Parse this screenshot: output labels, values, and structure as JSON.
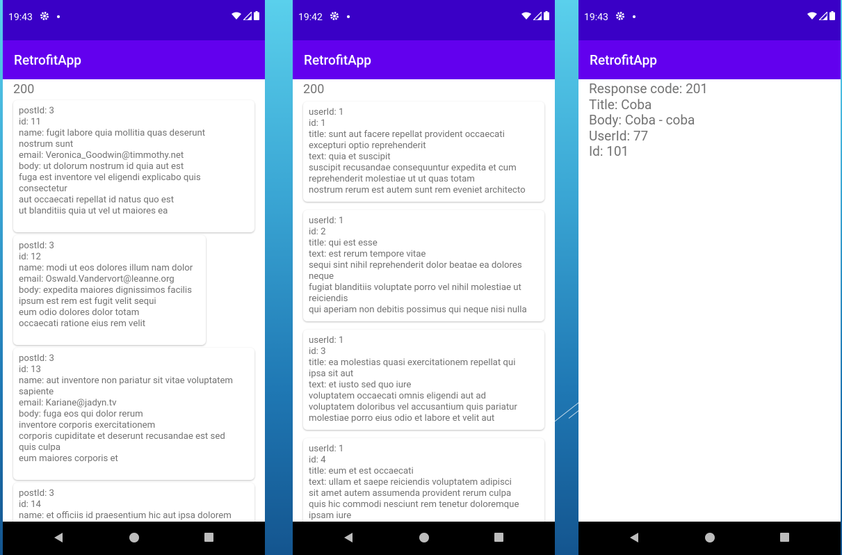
{
  "colors": {
    "status_bar": "#3a00c6",
    "app_bar": "#6200ee",
    "text": "#737373"
  },
  "phones": [
    {
      "status_time": "19:43",
      "app_title": "RetrofitApp",
      "code": "200",
      "cards": [
        {
          "lines": [
            "postId: 3",
            "id: 11",
            "name: fugit labore quia mollitia quas deserunt",
            "nostrum sunt",
            "email: Veronica_Goodwin@timmothy.net",
            "body: ut dolorum nostrum id quia aut est",
            "fuga est inventore vel eligendi explicabo quis",
            "consectetur",
            "aut occaecati repellat id natus quo est",
            "ut blanditiis quia ut vel ut maiores ea"
          ]
        },
        {
          "lines": [
            "postId: 3",
            "id: 12",
            "name: modi ut eos dolores illum nam dolor",
            "email: Oswald.Vandervort@leanne.org",
            "body: expedita maiores dignissimos facilis",
            "ipsum est rem est fugit velit sequi",
            "eum odio dolores dolor totam",
            "occaecati ratione eius rem velit"
          ]
        },
        {
          "lines": [
            "postId: 3",
            "id: 13",
            "name: aut inventore non pariatur sit vitae voluptatem",
            "sapiente",
            "email: Kariane@jadyn.tv",
            "body: fuga eos qui dolor rerum",
            "inventore corporis exercitationem",
            "corporis cupiditate et deserunt recusandae est sed",
            "quis culpa",
            "eum maiores corporis et"
          ]
        },
        {
          "lines": [
            "postId: 3",
            "id: 14",
            "name: et officiis id praesentium hic aut ipsa dolorem"
          ]
        }
      ]
    },
    {
      "status_time": "19:42",
      "app_title": "RetrofitApp",
      "code": "200",
      "cards": [
        {
          "lines": [
            "userId: 1",
            "id: 1",
            "title: sunt aut facere repellat provident occaecati",
            "excepturi optio reprehenderit",
            "text: quia et suscipit",
            "suscipit recusandae consequuntur expedita et cum",
            "reprehenderit molestiae ut ut quas totam",
            "nostrum rerum est autem sunt rem eveniet architecto"
          ]
        },
        {
          "lines": [
            "userId: 1",
            "id: 2",
            "title: qui est esse",
            "text: est rerum tempore vitae",
            "sequi sint nihil reprehenderit dolor beatae ea dolores",
            "neque",
            "fugiat blanditiis voluptate porro vel nihil molestiae ut",
            "reiciendis",
            "qui aperiam non debitis possimus qui neque nisi nulla"
          ]
        },
        {
          "lines": [
            "userId: 1",
            "id: 3",
            "title: ea molestias quasi exercitationem repellat qui",
            "ipsa sit aut",
            "text: et iusto sed quo iure",
            "voluptatem occaecati omnis eligendi aut ad",
            "voluptatem doloribus vel accusantium quis pariatur",
            "molestiae porro eius odio et labore et velit aut"
          ]
        },
        {
          "lines": [
            "userId: 1",
            "id: 4",
            "title: eum et est occaecati",
            "text: ullam et saepe reiciendis voluptatem adipisci",
            "sit amet autem assumenda provident rerum culpa",
            "quis hic commodi nesciunt rem tenetur doloremque",
            "ipsam iure"
          ]
        }
      ]
    },
    {
      "status_time": "19:43",
      "app_title": "RetrofitApp",
      "response": [
        "Response code: 201",
        "Title: Coba",
        "Body: Coba - coba",
        "UserId: 77",
        "Id: 101"
      ]
    }
  ]
}
